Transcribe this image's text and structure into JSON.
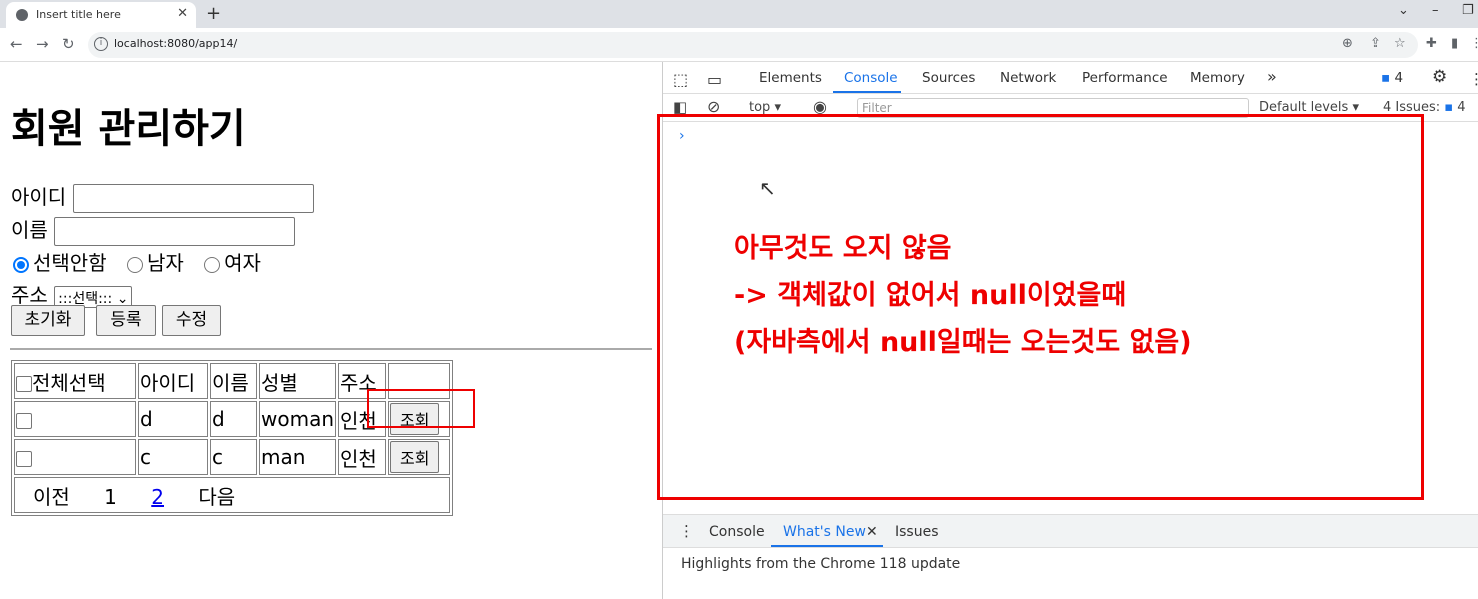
{
  "browser": {
    "tab_title": "Insert title here",
    "tab_close": "✕",
    "new_tab": "+",
    "url": "localhost:8080/app14/",
    "win_min": "⌄",
    "win_dash": "–",
    "win_restore": "❐"
  },
  "page": {
    "title": "회원 관리하기",
    "id_label": "아이디",
    "name_label": "이름",
    "gender_options": [
      "선택안함",
      "남자",
      "여자"
    ],
    "gender_selected": "선택안함",
    "address_label": "주소",
    "address_select": ":::선택:::",
    "buttons": {
      "reset": "초기화",
      "register": "등록",
      "update": "수정"
    },
    "table": {
      "headers": [
        "전체선택",
        "아이디",
        "이름",
        "성별",
        "주소",
        ""
      ],
      "rows": [
        {
          "id": "d",
          "name": "d",
          "gender": "woman",
          "address": "인천",
          "action": "조회"
        },
        {
          "id": "c",
          "name": "c",
          "gender": "man",
          "address": "인천",
          "action": "조회"
        }
      ],
      "pagination": {
        "prev": "이전",
        "pages": [
          "1",
          "2"
        ],
        "current": "1",
        "next": "다음"
      }
    }
  },
  "devtools": {
    "tabs": [
      "Elements",
      "Console",
      "Sources",
      "Network",
      "Performance",
      "Memory"
    ],
    "active_tab": "Console",
    "more": "»",
    "message_count": "4",
    "context": "top",
    "filter_placeholder": "Filter",
    "levels": "Default levels ▾",
    "issues_label": "4 Issues:",
    "issues_count": "4",
    "prompt": "›",
    "annotation": [
      "아무것도 오지 않음",
      "-> 객체값이 없어서 null이었을때",
      "(자바측에서 null일때는 오는것도 없음)"
    ],
    "drawer_tabs": [
      "Console",
      "What's New",
      "Issues"
    ],
    "drawer_active": "What's New",
    "drawer_text": "Highlights from the Chrome 118 update"
  },
  "colors": {
    "accent": "#1a73e8",
    "annotation": "#ee0000",
    "link": "#0000ee"
  }
}
